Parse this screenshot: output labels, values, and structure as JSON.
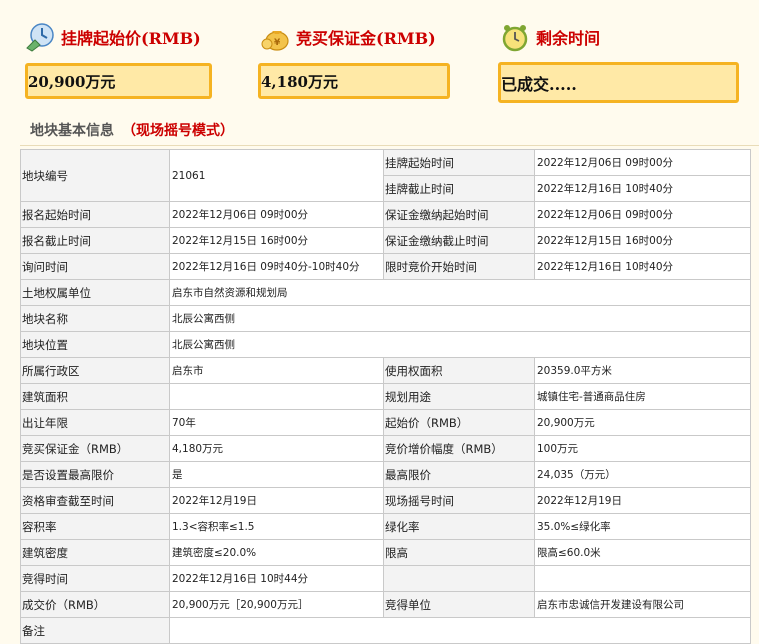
{
  "header": {
    "start_price_title": "挂牌起始价(RMB)",
    "deposit_title": "竞买保证金(RMB)",
    "time_left_title": "剩余时间",
    "start_price_value": "20,900万元",
    "deposit_value": "4,180万元",
    "time_left_value": "已成交....."
  },
  "section": {
    "title": "地块基本信息",
    "mode": "（现场摇号模式）"
  },
  "table": {
    "r1": {
      "label": "地块编号",
      "value": "21061",
      "l2a": "挂牌起始时间",
      "v2a": "2022年12月06日 09时00分",
      "l2b": "挂牌截止时间",
      "v2b": "2022年12月16日 10时40分"
    },
    "r2": {
      "l1": "报名起始时间",
      "v1": "2022年12月06日 09时00分",
      "l2": "保证金缴纳起始时间",
      "v2": "2022年12月06日 09时00分"
    },
    "r3": {
      "l1": "报名截止时间",
      "v1": "2022年12月15日 16时00分",
      "l2": "保证金缴纳截止时间",
      "v2": "2022年12月15日 16时00分"
    },
    "r4": {
      "l1": "询问时间",
      "v1": "2022年12月16日 09时40分-10时40分",
      "l2": "限时竞价开始时间",
      "v2": "2022年12月16日 10时40分"
    },
    "r5": {
      "l1": "土地权属单位",
      "v1": "启东市自然资源和规划局"
    },
    "r6": {
      "l1": "地块名称",
      "v1": "北辰公寓西侧"
    },
    "r7": {
      "l1": "地块位置",
      "v1": "北辰公寓西侧"
    },
    "r8": {
      "l1": "所属行政区",
      "v1": "启东市",
      "l2": "使用权面积",
      "v2": "20359.0平方米"
    },
    "r9": {
      "l1": "建筑面积",
      "v1": "",
      "l2": "规划用途",
      "v2": "城镇住宅-普通商品住房"
    },
    "r10": {
      "l1": "出让年限",
      "v1": "70年",
      "l2": "起始价（RMB）",
      "v2": "20,900万元"
    },
    "r11": {
      "l1": "竞买保证金（RMB）",
      "v1": "4,180万元",
      "l2": "竞价增价幅度（RMB）",
      "v2": "100万元"
    },
    "r12": {
      "l1": "是否设置最高限价",
      "v1": "是",
      "l2": "最高限价",
      "v2": "24,035（万元）"
    },
    "r13": {
      "l1": "资格审查截至时间",
      "v1": "2022年12月19日",
      "l2": "现场摇号时间",
      "v2": "2022年12月19日"
    },
    "r14": {
      "l1": "容积率",
      "v1": "1.3<容积率≤1.5",
      "l2": "绿化率",
      "v2": "35.0%≤绿化率"
    },
    "r15": {
      "l1": "建筑密度",
      "v1": "建筑密度≤20.0%",
      "l2": "限高",
      "v2": "限高≤60.0米"
    },
    "r16": {
      "l1": "竞得时间",
      "v1": "2022年12月16日 10时44分",
      "l2": "",
      "v2": ""
    },
    "r17": {
      "l1": "成交价（RMB）",
      "v1": "20,900万元［20,900万元］",
      "l2": "竞得单位",
      "v2": "启东市忠诚信开发建设有限公司"
    },
    "r18": {
      "l1": "备注",
      "v1": ""
    }
  },
  "colors": {
    "accent_red": "#cc0000",
    "box_fill": "#ffe9a6",
    "box_border": "#f5b322"
  },
  "icons": [
    "price-tag-icon",
    "money-bag-icon",
    "alarm-clock-icon"
  ]
}
